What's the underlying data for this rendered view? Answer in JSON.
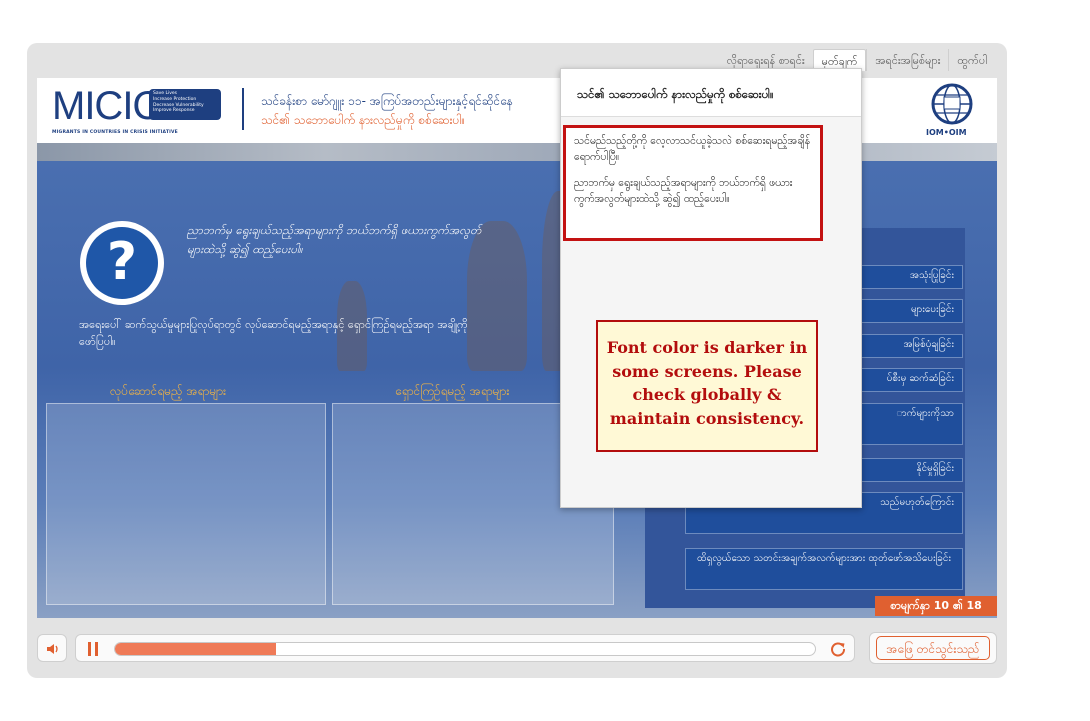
{
  "topnav": {
    "items": [
      "လိုရာရှေးရန် စာရင်း",
      "မှတ်ချက်",
      "အရင်းအမြစ်များ",
      "ထွက်ပါ"
    ],
    "active": "မှတ်ချက်"
  },
  "header": {
    "logo": {
      "name": "MICIC",
      "tagline_lines": [
        "Save Lives",
        "Increase Protection",
        "Decrease Vulnerability",
        "Improve Response"
      ],
      "subtitle": "MIGRANTS IN COUNTRIES IN CRISIS INITIATIVE"
    },
    "title": "သင်ခန်းစာ မော်ဂျူး ၁၁- အကြပ်အတည်းများနှင့်ရင်ဆိုင်နေ",
    "subtitle": "သင်၏ သဘောပေါက် နားလည်မှုကို စစ်ဆေးပါ။",
    "partner_logo": "IOM•OIM"
  },
  "activity": {
    "icon": "question-mark-icon",
    "instruction": "ညာဘက်မှ ရွေးချယ်သည့်အရာများကို ဘယ်ဘက်ရှိ ဖယားကွက်အလွတ်များထဲသို့ ဆွဲ၍ ထည့်ပေးပါ။",
    "scenario": "အရေးပေါ် ဆက်သွယ်မှုများပြုလုပ်ရာတွင် လုပ်ဆောင်ရမည့်အရာနှင့် ရှောင်ကြဉ်ရမည့်အရာ အချို့ကို ဖော်ပြပါ။",
    "do_label": "လုပ်ဆောင်ရမည့် အရာများ",
    "avoid_label": "ရှောင်ကြဉ်ရမည့် အရာများ",
    "answer_options": [
      "အသုံးပြုခြင်း",
      "များပေးခြင်း",
      "အမြစ်ပုံချခြင်း",
      "ပ်စီးမှ ဆက်ဆံခြင်း",
      "ာက်များကိုသာ",
      "နိုင်မှုရှိခြင်း",
      "သည်မဟုတ်ကြောင်း",
      "ထိရှလွယ်သော သတင်းအချက်အလက်များအား ထုတ်ဖော်အသိပေးခြင်း"
    ]
  },
  "slide_counter": "စာမျက်နှာ 10 ၏ 18",
  "notes_panel": {
    "heading": "သင်၏ သဘောပေါက် နားလည်မှုကို စစ်ဆေးပါ။",
    "paragraphs": [
      "သင်မည်သည့်တို့ကို လေ့လာသင်ယူခဲ့သလဲ စစ်ဆေးရမည့်အချိန်ရောက်ပါပြီ။",
      "ညာဘက်မှ ရွေးချယ်သည့်အရာများကို ဘယ်ဘက်ရှိ ဖယားကွက်အလွတ်များထဲသို့ ဆွဲ၍ ထည့်ပေးပါ။"
    ]
  },
  "review_comment": "Font color is darker in some screens. Please check globally & maintain consistency.",
  "controls": {
    "volume_icon": "speaker-icon",
    "pause_icon": "pause-icon",
    "replay_icon": "replay-icon",
    "progress": 0.23,
    "submit_label": "အဖြေ တင်သွင်းသည်"
  },
  "colors": {
    "accent": "#e06030",
    "brand_blue": "#1e3f80",
    "highlight_red": "#c31212",
    "progress_fill": "#ef7a57"
  }
}
